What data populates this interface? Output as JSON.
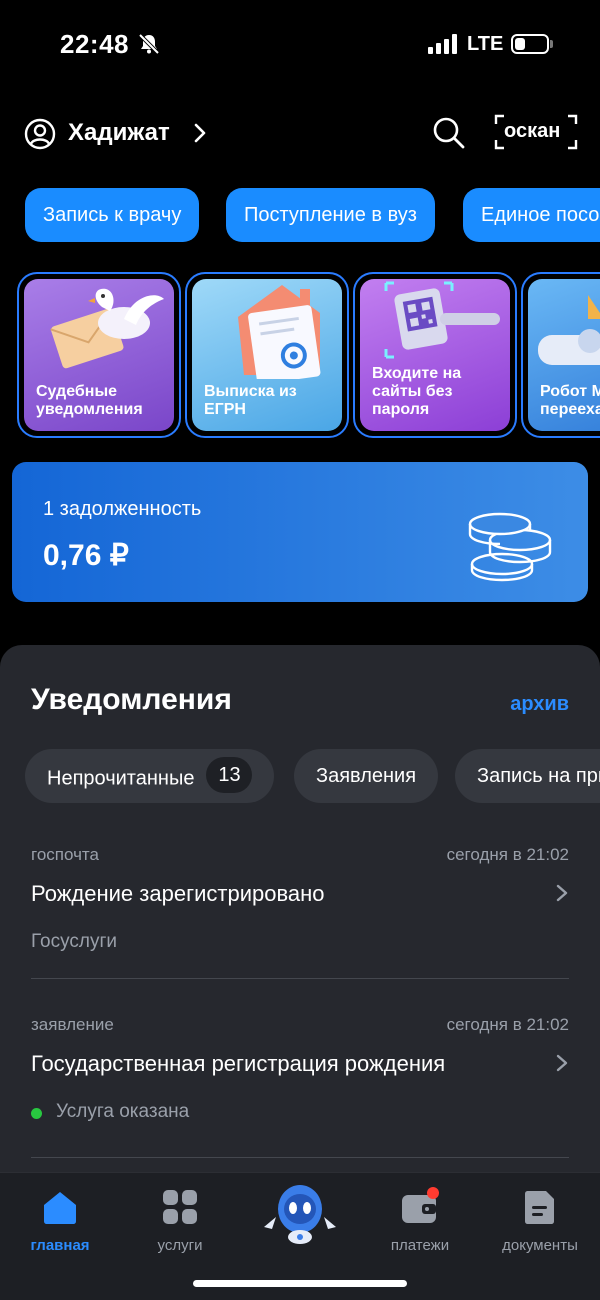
{
  "status_bar": {
    "time": "22:48",
    "network": "LTE"
  },
  "header": {
    "user_name": "Хадижат",
    "scan_label": "оскан"
  },
  "quick_chips": [
    {
      "label": "Запись к врачу"
    },
    {
      "label": "Поступление в вуз"
    },
    {
      "label": "Единое пособие"
    }
  ],
  "service_cards": [
    {
      "label_line1": "Судебные",
      "label_line2": "уведомления",
      "label_line3": ""
    },
    {
      "label_line1": "Выписка из",
      "label_line2": "ЕГРН",
      "label_line3": ""
    },
    {
      "label_line1": "Входите на",
      "label_line2": "сайты без",
      "label_line3": "пароля"
    },
    {
      "label_line1": "Робот Ма",
      "label_line2": "переехал",
      "label_line3": ""
    }
  ],
  "debt": {
    "label": "1 задолженность",
    "amount": "0,76 ₽"
  },
  "notifications": {
    "title": "Уведомления",
    "archive_label": "архив",
    "filters": [
      {
        "label": "Непрочитанные",
        "count": "13"
      },
      {
        "label": "Заявления"
      },
      {
        "label": "Запись на прием"
      }
    ],
    "items": [
      {
        "source": "госпочта",
        "time": "сегодня в 21:02",
        "title": "Рождение зарегистрировано",
        "subtitle": "Госуслуги"
      },
      {
        "source": "заявление",
        "time": "сегодня в 21:02",
        "title": "Государственная регистрация рождения",
        "status": "Услуга оказана"
      }
    ]
  },
  "tabbar": {
    "tabs": [
      {
        "label": "главная"
      },
      {
        "label": "услуги"
      },
      {
        "label": "платежи"
      },
      {
        "label": "документы"
      }
    ]
  },
  "colors": {
    "accent": "#1a8cff",
    "link": "#2b8cff",
    "panel": "#26282e",
    "status_ok": "#28c840",
    "badge": "#ff3b30"
  }
}
